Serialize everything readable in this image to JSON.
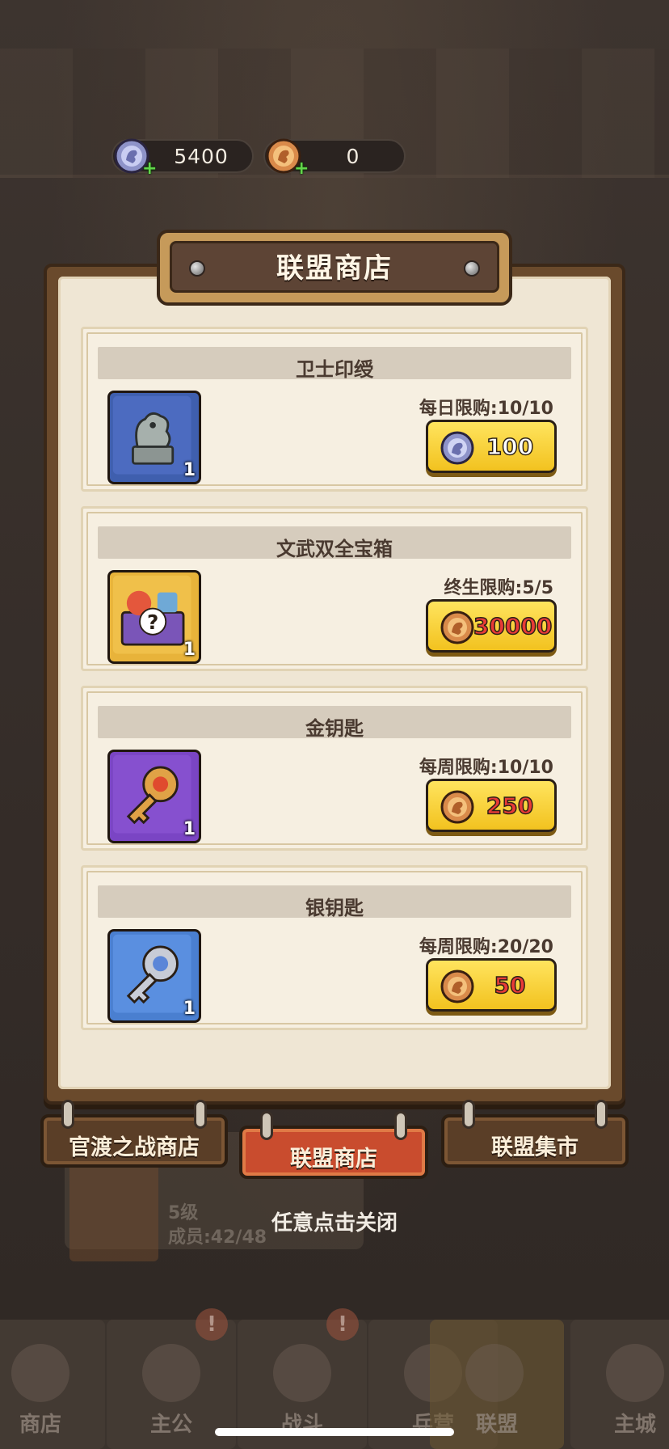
{
  "currency": {
    "silver_amount": "5400",
    "gold_amount": "0"
  },
  "shop": {
    "title": "联盟商店",
    "items": [
      {
        "name": "卫士印绶",
        "quantity": "1",
        "limit": "每日限购:10/10",
        "price": "100",
        "coin": "silver-dragon-coin"
      },
      {
        "name": "文武双全宝箱",
        "quantity": "1",
        "limit": "终生限购:5/5",
        "price": "30000",
        "coin": "gold-dragon-coin"
      },
      {
        "name": "金钥匙",
        "quantity": "1",
        "limit": "每周限购:10/10",
        "price": "250",
        "coin": "gold-dragon-coin"
      },
      {
        "name": "银钥匙",
        "quantity": "1",
        "limit": "每周限购:20/20",
        "price": "50",
        "coin": "gold-dragon-coin"
      }
    ]
  },
  "tabs": [
    {
      "label": "官渡之战商店",
      "active": false
    },
    {
      "label": "联盟商店",
      "active": true
    },
    {
      "label": "联盟集市",
      "active": false
    }
  ],
  "close_hint": "任意点击关闭",
  "background": {
    "guild_level": "5级",
    "guild_members": "成员:42/48"
  },
  "bottom_nav": [
    {
      "label": "商店",
      "icon": "shop-icon",
      "alert": false
    },
    {
      "label": "主公",
      "icon": "lord-icon",
      "alert": true
    },
    {
      "label": "战斗",
      "icon": "battle-icon",
      "alert": true
    },
    {
      "label": "兵营",
      "icon": "barracks-icon",
      "alert": false
    },
    {
      "label": "联盟",
      "icon": "alliance-icon",
      "alert": false,
      "active": true
    },
    {
      "label": "主城",
      "icon": "castle-icon",
      "alert": false
    }
  ],
  "colors": {
    "button_gold": "#f2c21f",
    "price_red": "#e83b37",
    "active_tab": "#c94c2e",
    "panel_paper": "#efe6d4"
  }
}
